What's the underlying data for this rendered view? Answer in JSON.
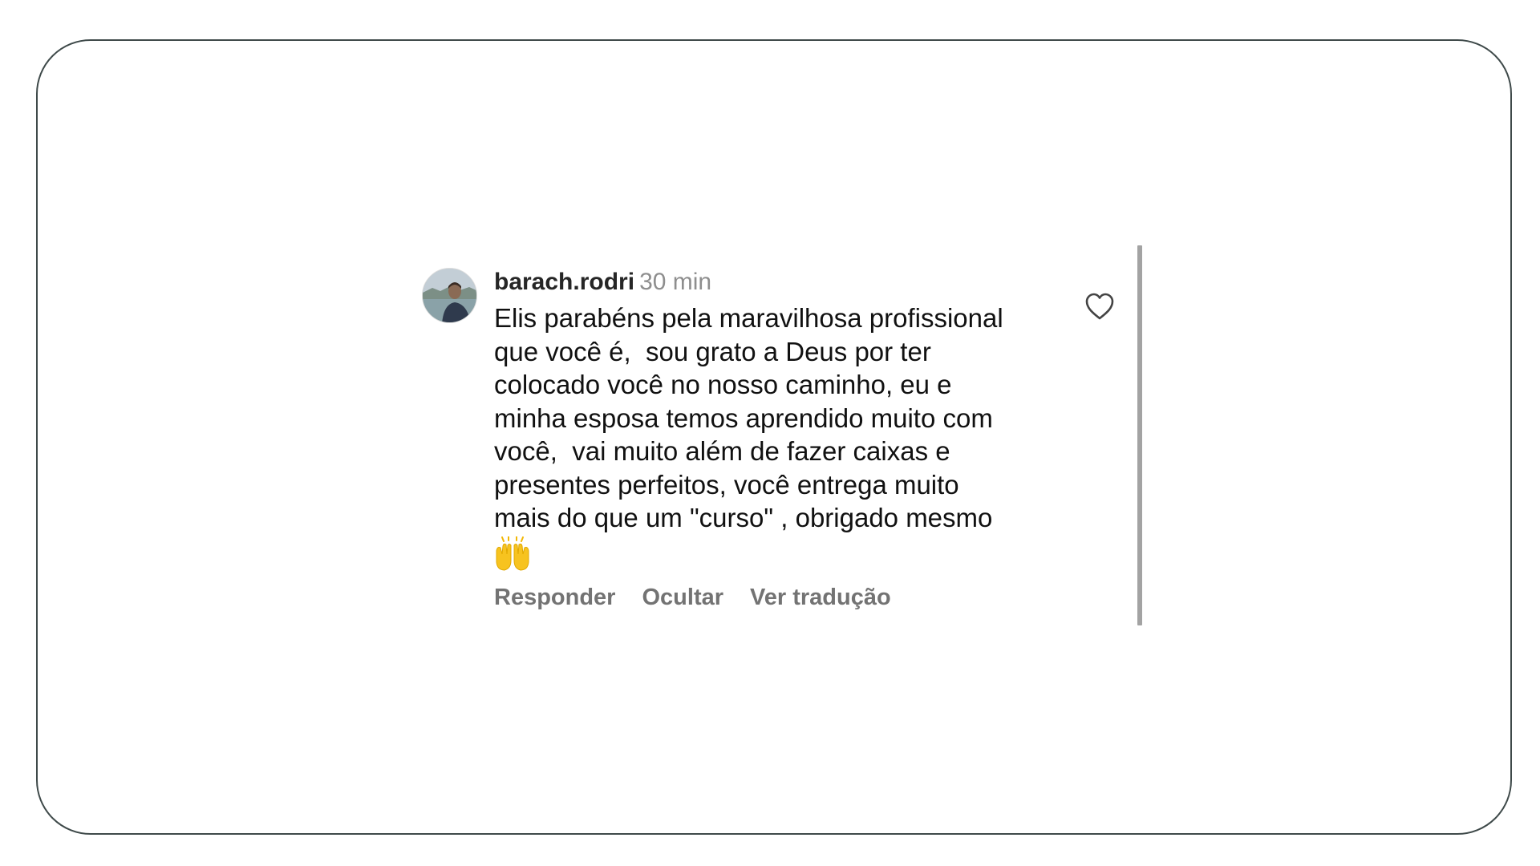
{
  "comment": {
    "username": "barach.rodri",
    "time": "30 min",
    "text": "Elis parabéns pela maravilhosa profissional\nque você é,  sou grato a Deus por ter\ncolocado você no nosso caminho, eu e\nminha esposa temos aprendido muito com\nvocê,  vai muito além de fazer caixas e\npresentes perfeitos, você entrega muito\nmais do que um \"curso\" , obrigado mesmo",
    "emoji": "raised-hands",
    "actions": {
      "reply": "Responder",
      "hide": "Ocultar",
      "translate": "Ver tradução"
    },
    "like_icon": "heart-outline-icon"
  },
  "colors": {
    "text": "#111111",
    "username": "#262626",
    "muted": "#8e8e8e",
    "action": "#737373",
    "scrollbar": "#a3a3a3",
    "frame_border": "#3f4a4a",
    "emoji": "#f7c31f"
  }
}
